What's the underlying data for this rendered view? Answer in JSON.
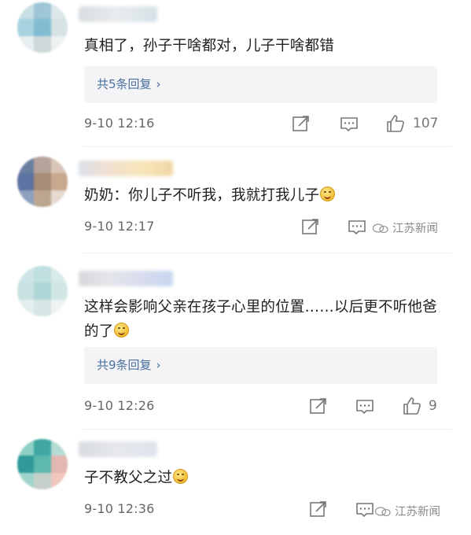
{
  "comments": [
    {
      "content": "真相了，孙子干啥都对，儿子干啥都错",
      "replies_label": "共5条回复",
      "time": "9-10 12:16",
      "likes": "107"
    },
    {
      "content": "奶奶：你儿子不听我，我就打我儿子",
      "time": "9-10 12:17"
    },
    {
      "content": "这样会影响父亲在孩子心里的位置……以后更不听他爸的了",
      "replies_label": "共9条回复",
      "time": "9-10 12:26",
      "likes": "9"
    },
    {
      "content": "子不教父之过",
      "time": "9-10 12:36"
    }
  ],
  "watermark": "江苏新闻",
  "icons": {
    "share": "share-icon",
    "comment": "comment-icon",
    "like": "thumbs-up-icon",
    "emoji": "smiley-emoji-icon",
    "replies_chevron": "chevron-right-icon"
  },
  "colors": {
    "link": "#4a6fa0",
    "reply_bg": "#f4f4f6",
    "meta_text": "#666666"
  }
}
